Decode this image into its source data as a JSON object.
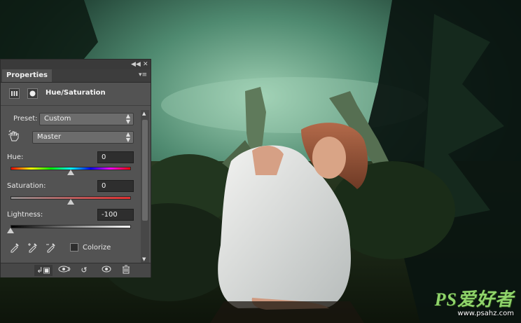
{
  "panel": {
    "tab_label": "Properties",
    "title": "Hue/Saturation",
    "preset_label": "Preset:",
    "preset_value": "Custom",
    "channel_value": "Master",
    "hue": {
      "label": "Hue:",
      "value": "0",
      "slider_fraction": 0.5
    },
    "saturation": {
      "label": "Saturation:",
      "value": "0",
      "slider_fraction": 0.5
    },
    "lightness": {
      "label": "Lightness:",
      "value": "-100",
      "slider_fraction": 0.0
    },
    "colorize_label": "Colorize",
    "colorize_checked": false,
    "icons": {
      "collapse": "double-chevron-left-icon",
      "close": "close-icon",
      "menu": "panel-menu-icon",
      "adjustment": "adjustment-layer-icon",
      "mask": "layer-mask-icon",
      "hand": "targeted-adjustment-hand-icon",
      "eyedroppers": [
        "eyedropper-icon",
        "eyedropper-plus-icon",
        "eyedropper-minus-icon"
      ],
      "footer": [
        "clip-to-layer-icon",
        "view-previous-state-icon",
        "reset-icon",
        "visibility-icon",
        "trash-icon"
      ]
    }
  },
  "watermark": {
    "logo": "PS爱好者",
    "url": "www.psahz.com"
  },
  "colors": {
    "panel_bg": "#535353",
    "field_bg": "#2e2e2e",
    "watermark_green": "#8fd46a"
  }
}
